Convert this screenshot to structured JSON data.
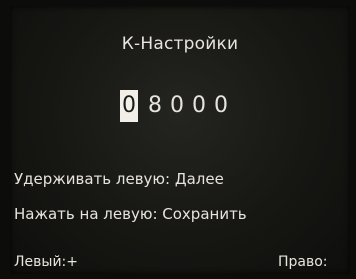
{
  "screen": {
    "title": "К-Настройки",
    "code_digits": [
      "0",
      "8",
      "0",
      "0",
      "0"
    ],
    "selected_digit_index": 0,
    "hint_hold": "Удерживать левую: Далее",
    "hint_press": "Нажать на левую: Сохранить",
    "softkey_left": "Левый:+",
    "softkey_right": "Право:"
  },
  "colors": {
    "screen_background": "#161613",
    "text": "#e6e4dc",
    "selection_highlight": "#f1efe8"
  }
}
